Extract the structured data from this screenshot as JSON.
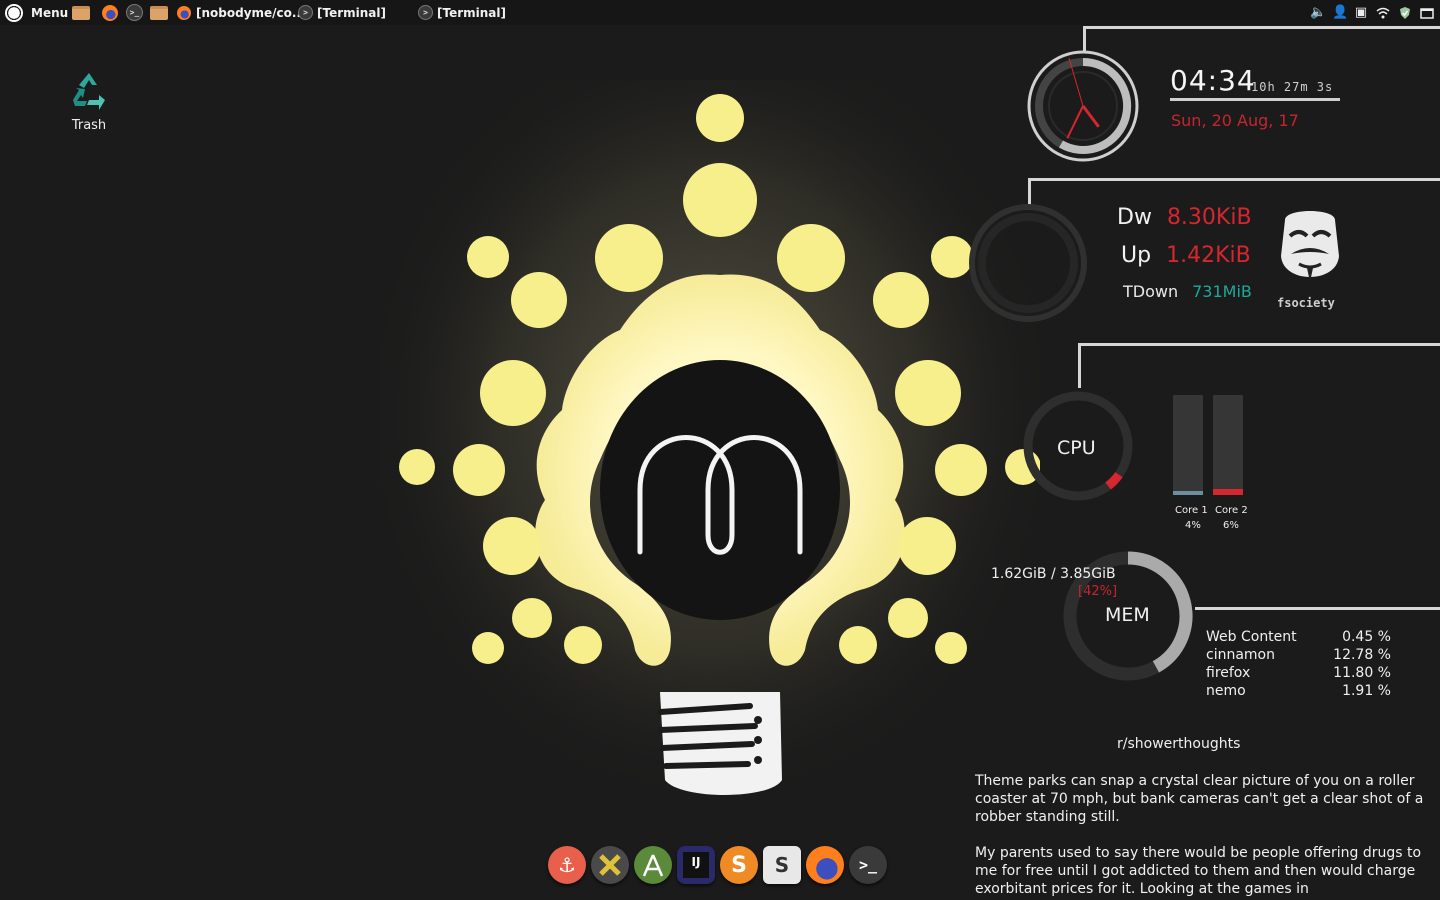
{
  "panel": {
    "menu_label": "Menu",
    "windows": [
      {
        "label": "[nobodyme/co...",
        "icon": "firefox-icon"
      },
      {
        "label": "[Terminal]",
        "icon": "terminal-icon"
      },
      {
        "label": "[Terminal]",
        "icon": "terminal-icon"
      }
    ],
    "tray_icons": [
      "volume-icon",
      "user-icon",
      "display-icon",
      "wifi-icon",
      "shield-icon",
      "window-icon"
    ]
  },
  "desktop": {
    "trash_label": "Trash"
  },
  "conky": {
    "clock": {
      "time": "04:34",
      "uptime": "10h 27m 3s",
      "date": "Sun, 20 Aug, 17",
      "hour_hand_angle": 143,
      "minute_hand_angle": 206
    },
    "network": {
      "down_key": "Dw",
      "down_value": "8.30KiB",
      "up_key": "Up",
      "up_value": "1.42KiB",
      "total_key": "TDown",
      "total_value": "731MiB",
      "logo_text": "fsociety"
    },
    "cpu": {
      "label": "CPU",
      "usage_fraction": 0.05,
      "cores": [
        {
          "name": "Core 1",
          "pct": "4%",
          "value": 0.04,
          "color": "#6a8fa0"
        },
        {
          "name": "Core 2",
          "pct": "6%",
          "value": 0.06,
          "color": "#d6262e"
        }
      ]
    },
    "memory": {
      "used": "1.62GiB / 3.85GiB",
      "pct": "[42%]",
      "value": 0.42,
      "label": "MEM"
    },
    "processes": [
      {
        "name": "Web Content",
        "cpu": "0.45 %"
      },
      {
        "name": "cinnamon",
        "cpu": "12.78 %"
      },
      {
        "name": "firefox",
        "cpu": "11.80 %"
      },
      {
        "name": "nemo",
        "cpu": "1.91 %"
      }
    ],
    "reddit": {
      "title": "r/showerthoughts",
      "posts": [
        "Theme parks can snap a crystal clear picture of you on a roller coaster at 70 mph, but bank cameras can't get a clear shot of a robber standing still.",
        "My parents used to say there would be people offering drugs to me for free until I got addicted to them and then would charge exorbitant prices for it. Looking at the games in"
      ]
    },
    "accent_red": "#d6262e",
    "accent_teal": "#1ca89a"
  },
  "dock": [
    {
      "name": "anchor-app-icon",
      "color": "#e8604c"
    },
    {
      "name": "xampp-app-icon",
      "color": "#5a5a5a"
    },
    {
      "name": "android-studio-icon",
      "color": "#5b8a3a"
    },
    {
      "name": "intellij-icon",
      "color": "#2a2a6a"
    },
    {
      "name": "sublime-text-icon",
      "color": "#f08a24"
    },
    {
      "name": "slack-icon",
      "color": "#e8e8e8"
    },
    {
      "name": "firefox-icon",
      "color": "#ff7f1f"
    },
    {
      "name": "terminal-icon",
      "color": "#3a3a3a"
    }
  ]
}
